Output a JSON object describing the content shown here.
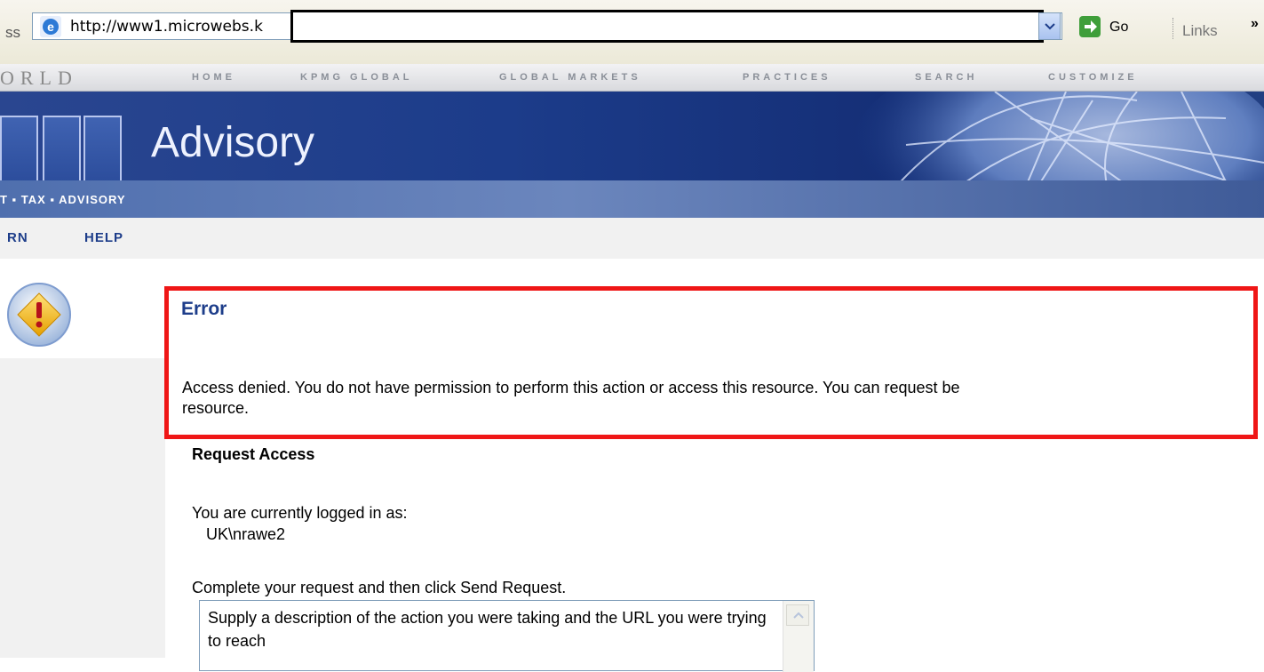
{
  "browser": {
    "address_label": "ss",
    "url": "http://www1.microwebs.k",
    "go_label": "Go",
    "links_label": "Links",
    "overflow_label": "»"
  },
  "site": {
    "world_text": "ORLD",
    "topnav": [
      "HOME",
      "KPMG GLOBAL",
      "GLOBAL MARKETS",
      "PRACTICES",
      "SEARCH",
      "CUSTOMIZE"
    ],
    "banner_title": "Advisory",
    "tagline": "T ▪ TAX ▪ ADVISORY",
    "subnav": [
      "RN",
      "HELP"
    ]
  },
  "error": {
    "title": "Error",
    "message_line1": "Access denied. You do not have permission to perform this action or access this resource. You can request be",
    "message_line2": "resource."
  },
  "request": {
    "heading": "Request Access",
    "logged_in_label": "You are currently logged in as:",
    "user": "UK\\nrawe2",
    "instruction": "Complete your request and then click Send Request.",
    "textarea_value": "Supply a description of the action you were taking and the URL you were trying to reach"
  },
  "colors": {
    "accent_blue": "#1d3d8a",
    "highlight_red": "#ef1616",
    "banner_blue": "#1c3c8a"
  }
}
